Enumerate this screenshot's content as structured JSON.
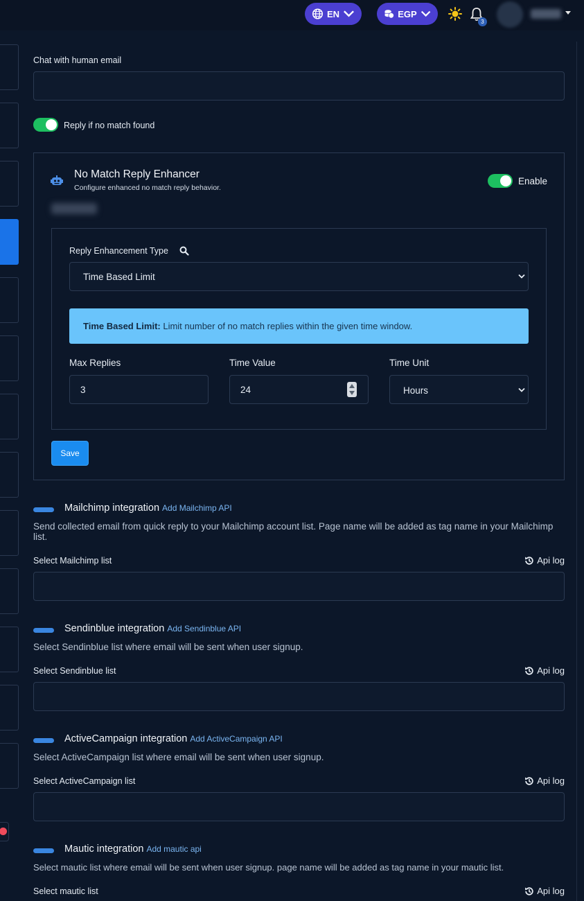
{
  "topbar": {
    "language": "EN",
    "currency": "EGP",
    "notification_count": "3",
    "icons": [
      "globe-icon",
      "coins-icon",
      "sun-icon",
      "bell-icon",
      "chevron-down-icon"
    ]
  },
  "chat_email": {
    "label": "Chat with human email",
    "value": ""
  },
  "reply_toggle": {
    "label": "Reply if no match found",
    "on": true
  },
  "enhancer": {
    "title": "No Match Reply Enhancer",
    "subtitle": "Configure enhanced no match reply behavior.",
    "enable_label": "Enable",
    "enabled": true,
    "type_label": "Reply Enhancement Type",
    "type_value": "Time Based Limit",
    "info_strong": "Time Based Limit:",
    "info_text": " Limit number of no match replies within the given time window.",
    "max_replies_label": "Max Replies",
    "max_replies_value": "3",
    "time_value_label": "Time Value",
    "time_value_value": "24",
    "time_unit_label": "Time Unit",
    "time_unit_value": "Hours",
    "save_label": "Save"
  },
  "integrations": {
    "mailchimp": {
      "title": "Mailchimp integration",
      "link": "Add Mailchimp API",
      "desc": "Send collected email from quick reply to your Mailchimp account list. Page name will be added as tag name in your Mailchimp list.",
      "select_label": "Select Mailchimp list",
      "api_log": "Api log"
    },
    "sendinblue": {
      "title": "Sendinblue integration",
      "link": "Add Sendinblue API",
      "desc": "Select Sendinblue list where email will be sent when user signup.",
      "select_label": "Select Sendinblue list",
      "api_log": "Api log"
    },
    "activecampaign": {
      "title": "ActiveCampaign integration",
      "link": "Add ActiveCampaign API",
      "desc": "Select ActiveCampaign list where email will be sent when user signup.",
      "select_label": "Select ActiveCampaign list",
      "api_log": "Api log"
    },
    "mautic": {
      "title": "Mautic integration",
      "link": "Add mautic api",
      "desc": "Select mautic list where email will be sent when user signup. page name will be added as tag name in your mautic list.",
      "select_label": "Select mautic list",
      "api_log": "Api log"
    }
  },
  "colors": {
    "background": "#0c1729",
    "accent": "#1a73e8",
    "toggle_on": "#1dbf60",
    "info_box": "#6ac4fb",
    "pill": "#4b3fd1"
  }
}
